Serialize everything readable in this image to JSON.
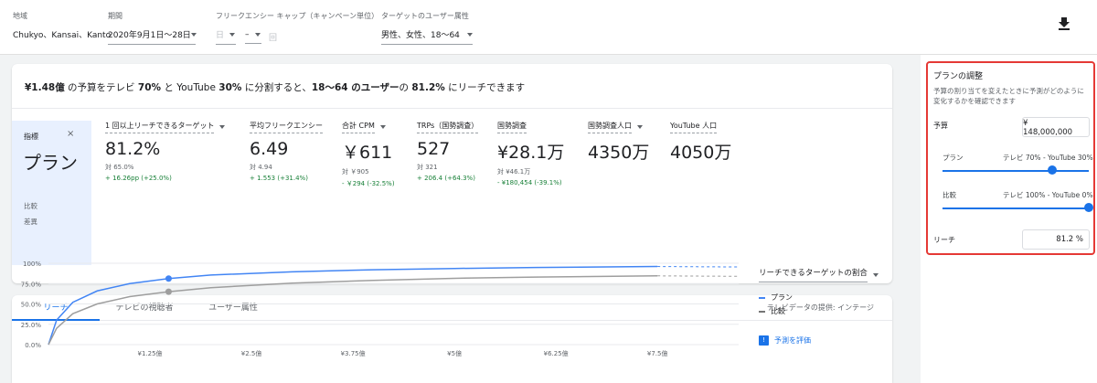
{
  "filters": {
    "region": {
      "label": "地域",
      "value": "Chukyo、Kansai、Kanto"
    },
    "period": {
      "label": "期間",
      "value": "2020年9月1日〜28日"
    },
    "freqcap": {
      "label": "フリークエンシー キャップ（キャンペーン単位）",
      "value1": "日",
      "value2": "–",
      "value3": "回"
    },
    "target": {
      "label": "ターゲットのユーザー属性",
      "value": "男性、女性、18〜64"
    }
  },
  "headline": {
    "p1": "¥1.48億",
    "p2": " の予算をテレビ ",
    "p3": "70%",
    "p4": " と YouTube ",
    "p5": "30%",
    "p6": " に分割すると、",
    "p7": "18〜64 のユーザー",
    "p8": "の ",
    "p9": "81.2%",
    "p10": " にリーチできます"
  },
  "metric_panel": {
    "label": "指標",
    "close": "×",
    "plan": "プラン",
    "compare": "比較",
    "diff": "差異"
  },
  "metrics": [
    {
      "title": "1 回以上リーチできるターゲット",
      "value": "81.2%",
      "compare": "対 65.0%",
      "diff": "+ 16.26pp (+25.0%)"
    },
    {
      "title": "平均フリークエンシー",
      "value": "6.49",
      "compare": "対 4.94",
      "diff": "+ 1.553 (+31.4%)"
    },
    {
      "title": "合計 CPM",
      "value": "￥611",
      "compare": "対 ￥905",
      "diff": "- ￥294 (-32.5%)"
    },
    {
      "title": "TRPs（国勢調査）",
      "value": "527",
      "compare": "対 321",
      "diff": "+ 206.4 (+64.3%)"
    },
    {
      "title": "国勢調査",
      "value": "¥28.1万",
      "compare": "対 ¥46.1万",
      "diff": "- ¥180,454 (-39.1%)"
    },
    {
      "title": "国勢調査人口",
      "value": "4350万",
      "compare": "",
      "diff": ""
    },
    {
      "title": "YouTube 人口",
      "value": "4050万",
      "compare": "",
      "diff": ""
    }
  ],
  "tabs": [
    "リーチ",
    "テレビの視聴者",
    "ユーザー属性"
  ],
  "tv_provider": "テレビデータの提供: インテージ",
  "chart_data": {
    "type": "line",
    "x_ticks": [
      "¥1.25億",
      "¥2.5億",
      "¥3.75億",
      "¥5億",
      "¥6.25億",
      "¥7.5億"
    ],
    "y_ticks": [
      "0.0%",
      "25.0%",
      "50.0%",
      "75.0%",
      "100%"
    ],
    "ylim": [
      0,
      100
    ],
    "xlim": [
      0,
      8.5
    ],
    "series": [
      {
        "name": "プラン",
        "color": "#4285f4",
        "x": [
          0,
          0.1,
          0.3,
          0.6,
          1.0,
          1.48,
          2.0,
          3.0,
          4.0,
          5.0,
          6.0,
          7.5
        ],
        "values": [
          0,
          30,
          52,
          66,
          75,
          81.2,
          85.5,
          89.5,
          92.0,
          93.6,
          94.8,
          96.0
        ],
        "marker_x": 1.48,
        "marker_y": 81.2
      },
      {
        "name": "比較",
        "color": "#9e9e9e",
        "x": [
          0,
          0.1,
          0.3,
          0.6,
          1.0,
          1.48,
          2.0,
          3.0,
          4.0,
          5.0,
          6.0,
          7.5
        ],
        "values": [
          0,
          20,
          38,
          50,
          59,
          65.0,
          70,
          75.5,
          79,
          81.5,
          83.0,
          84.5
        ],
        "marker_x": 1.48,
        "marker_y": 65.0
      }
    ]
  },
  "legend": {
    "selector": "リーチできるターゲットの割合",
    "plan": "プラン",
    "compare": "比較",
    "evaluate": "予測を評価"
  },
  "plan_adjust": {
    "title": "プランの調整",
    "desc": "予算の割り当てを変えたときに予測がどのように変化するかを確認できます",
    "budget_label": "予算",
    "budget_value": "¥　148,000,000",
    "plan_label": "プラン",
    "plan_value": "テレビ 70% - YouTube 30%",
    "plan_slider_fraction": 0.75,
    "compare_label": "比較",
    "compare_value": "テレビ 100% - YouTube 0%",
    "compare_slider_fraction": 1.0,
    "reach_label": "リーチ",
    "reach_value": "81.2 %"
  }
}
